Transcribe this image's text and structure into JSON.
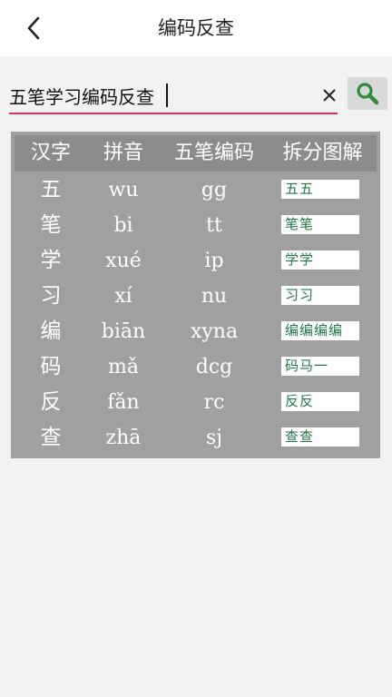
{
  "header": {
    "title": "编码反查",
    "back_icon": "chevron-left-icon"
  },
  "search": {
    "value": "五笔学习编码反查",
    "clear_icon": "close-icon",
    "search_icon": "magnifier-icon",
    "accent_color": "#d6336c",
    "icon_color": "#2e8b3a"
  },
  "table": {
    "headers": [
      "汉字",
      "拼音",
      "五笔编码",
      "拆分图解"
    ],
    "rows": [
      {
        "char": "五",
        "pinyin": "wu",
        "code": "gg",
        "decomp": "五五"
      },
      {
        "char": "笔",
        "pinyin": "bi",
        "code": "tt",
        "decomp": "笔笔"
      },
      {
        "char": "学",
        "pinyin": "xué",
        "code": "ip",
        "decomp": "学学"
      },
      {
        "char": "习",
        "pinyin": "xí",
        "code": "nu",
        "decomp": "习习"
      },
      {
        "char": "编",
        "pinyin": "biān",
        "code": "xyna",
        "decomp": "编编编编"
      },
      {
        "char": "码",
        "pinyin": "mǎ",
        "code": "dcg",
        "decomp": "码马一"
      },
      {
        "char": "反",
        "pinyin": "fǎn",
        "code": "rc",
        "decomp": "反反"
      },
      {
        "char": "查",
        "pinyin": "zhā",
        "code": "sj",
        "decomp": "查查"
      }
    ]
  }
}
